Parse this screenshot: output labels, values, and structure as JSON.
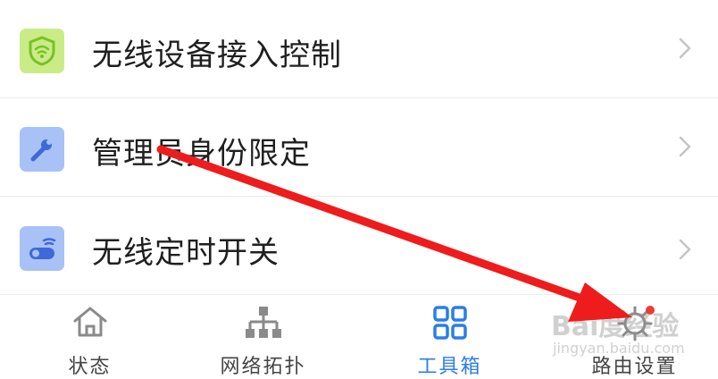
{
  "list": {
    "items": [
      {
        "label": "无线设备接入控制",
        "icon": "wifi-shield-icon",
        "icon_bg": "#c9ec86",
        "icon_fg": "#7bbf28"
      },
      {
        "label": "管理员身份限定",
        "icon": "wrench-icon",
        "icon_bg": "#a8c1f7",
        "icon_fg": "#3f69d6"
      },
      {
        "label": "无线定时开关",
        "icon": "wifi-toggle-icon",
        "icon_bg": "#a8c1f7",
        "icon_fg": "#3f69d6"
      }
    ]
  },
  "tabbar": {
    "tabs": [
      {
        "label": "状态",
        "icon": "home-icon",
        "active": false
      },
      {
        "label": "网络拓扑",
        "icon": "topology-icon",
        "active": false
      },
      {
        "label": "工具箱",
        "icon": "grid-icon",
        "active": true
      },
      {
        "label": "路由设置",
        "icon": "gear-icon",
        "active": false,
        "badge_dot": true
      }
    ],
    "active_color": "#2b7de9",
    "inactive_color": "#8a8a8a"
  },
  "watermark": {
    "text": "Bai度经验",
    "sub": "jingyan.baidu.com"
  },
  "annotation": {
    "arrow_color": "#ee1c1c"
  }
}
